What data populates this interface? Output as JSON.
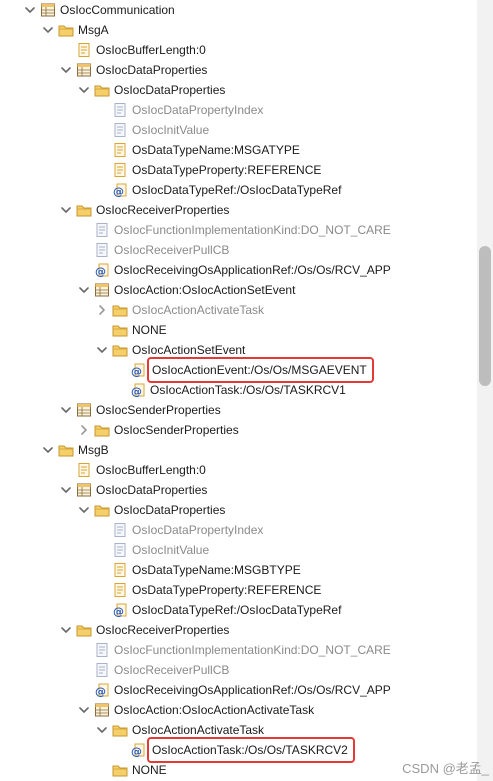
{
  "tree": [
    {
      "depth": 0,
      "exp": "open",
      "icon": "table-icon",
      "label": "OsIocCommunication"
    },
    {
      "depth": 1,
      "exp": "open",
      "icon": "folder-icon",
      "label": "MsgA"
    },
    {
      "depth": 2,
      "exp": "",
      "icon": "param-icon",
      "label": "OsIocBufferLength:0"
    },
    {
      "depth": 2,
      "exp": "open",
      "icon": "table-icon",
      "label": "OsIocDataProperties"
    },
    {
      "depth": 3,
      "exp": "open",
      "icon": "folder-icon",
      "label": "OsIocDataProperties"
    },
    {
      "depth": 4,
      "exp": "",
      "icon": "param-dim-icon",
      "label": "OsIocDataPropertyIndex",
      "dim": true
    },
    {
      "depth": 4,
      "exp": "",
      "icon": "param-dim-icon",
      "label": "OsIocInitValue",
      "dim": true
    },
    {
      "depth": 4,
      "exp": "",
      "icon": "param-icon",
      "label": "OsDataTypeName:MSGATYPE"
    },
    {
      "depth": 4,
      "exp": "",
      "icon": "param-icon",
      "label": "OsDataTypeProperty:REFERENCE"
    },
    {
      "depth": 4,
      "exp": "",
      "icon": "ref-icon",
      "label": "OsIocDataTypeRef:/OsIocDataTypeRef"
    },
    {
      "depth": 2,
      "exp": "open",
      "icon": "folder-icon",
      "label": "OsIocReceiverProperties"
    },
    {
      "depth": 3,
      "exp": "",
      "icon": "param-dim-icon",
      "label": "OsIocFunctionImplementationKind:DO_NOT_CARE",
      "dim": true
    },
    {
      "depth": 3,
      "exp": "",
      "icon": "param-dim-icon",
      "label": "OsIocReceiverPullCB",
      "dim": true
    },
    {
      "depth": 3,
      "exp": "",
      "icon": "ref-icon",
      "label": "OsIocReceivingOsApplicationRef:/Os/Os/RCV_APP"
    },
    {
      "depth": 3,
      "exp": "open",
      "icon": "table-icon",
      "label": "OsIocAction:OsIocActionSetEvent"
    },
    {
      "depth": 4,
      "exp": "closed",
      "icon": "folder-icon",
      "label": "OsIocActionActivateTask",
      "dim": true
    },
    {
      "depth": 4,
      "exp": "",
      "icon": "folder-icon",
      "label": "NONE"
    },
    {
      "depth": 4,
      "exp": "open",
      "icon": "folder-icon",
      "label": "OsIocActionSetEvent"
    },
    {
      "depth": 5,
      "exp": "",
      "icon": "ref-icon",
      "label": "OsIocActionEvent:/Os/Os/MSGAEVENT",
      "hl": true
    },
    {
      "depth": 5,
      "exp": "",
      "icon": "ref-icon",
      "label": "OsIocActionTask:/Os/Os/TASKRCV1"
    },
    {
      "depth": 2,
      "exp": "open",
      "icon": "table-icon",
      "label": "OsIocSenderProperties"
    },
    {
      "depth": 3,
      "exp": "closed",
      "icon": "folder-icon",
      "label": "OsIocSenderProperties"
    },
    {
      "depth": 1,
      "exp": "open",
      "icon": "folder-icon",
      "label": "MsgB"
    },
    {
      "depth": 2,
      "exp": "",
      "icon": "param-icon",
      "label": "OsIocBufferLength:0"
    },
    {
      "depth": 2,
      "exp": "open",
      "icon": "table-icon",
      "label": "OsIocDataProperties"
    },
    {
      "depth": 3,
      "exp": "open",
      "icon": "folder-icon",
      "label": "OsIocDataProperties"
    },
    {
      "depth": 4,
      "exp": "",
      "icon": "param-dim-icon",
      "label": "OsIocDataPropertyIndex",
      "dim": true
    },
    {
      "depth": 4,
      "exp": "",
      "icon": "param-dim-icon",
      "label": "OsIocInitValue",
      "dim": true
    },
    {
      "depth": 4,
      "exp": "",
      "icon": "param-icon",
      "label": "OsDataTypeName:MSGBTYPE"
    },
    {
      "depth": 4,
      "exp": "",
      "icon": "param-icon",
      "label": "OsDataTypeProperty:REFERENCE"
    },
    {
      "depth": 4,
      "exp": "",
      "icon": "ref-icon",
      "label": "OsIocDataTypeRef:/OsIocDataTypeRef"
    },
    {
      "depth": 2,
      "exp": "open",
      "icon": "folder-icon",
      "label": "OsIocReceiverProperties"
    },
    {
      "depth": 3,
      "exp": "",
      "icon": "param-dim-icon",
      "label": "OsIocFunctionImplementationKind:DO_NOT_CARE",
      "dim": true
    },
    {
      "depth": 3,
      "exp": "",
      "icon": "param-dim-icon",
      "label": "OsIocReceiverPullCB",
      "dim": true
    },
    {
      "depth": 3,
      "exp": "",
      "icon": "ref-icon",
      "label": "OsIocReceivingOsApplicationRef:/Os/Os/RCV_APP"
    },
    {
      "depth": 3,
      "exp": "open",
      "icon": "table-icon",
      "label": "OsIocAction:OsIocActionActivateTask"
    },
    {
      "depth": 4,
      "exp": "open",
      "icon": "folder-icon",
      "label": "OsIocActionActivateTask"
    },
    {
      "depth": 5,
      "exp": "",
      "icon": "ref-icon",
      "label": "OsIocActionTask:/Os/Os/TASKRCV2",
      "hl": true
    },
    {
      "depth": 4,
      "exp": "",
      "icon": "folder-icon",
      "label": "NONE"
    }
  ],
  "watermark": "CSDN @老孟_",
  "colors": {
    "highlight": "#e53935",
    "dim_text": "#8a8a8a",
    "folder": "#e6b84a",
    "param": "#f2c14e",
    "ref": "#3b6fd6"
  }
}
